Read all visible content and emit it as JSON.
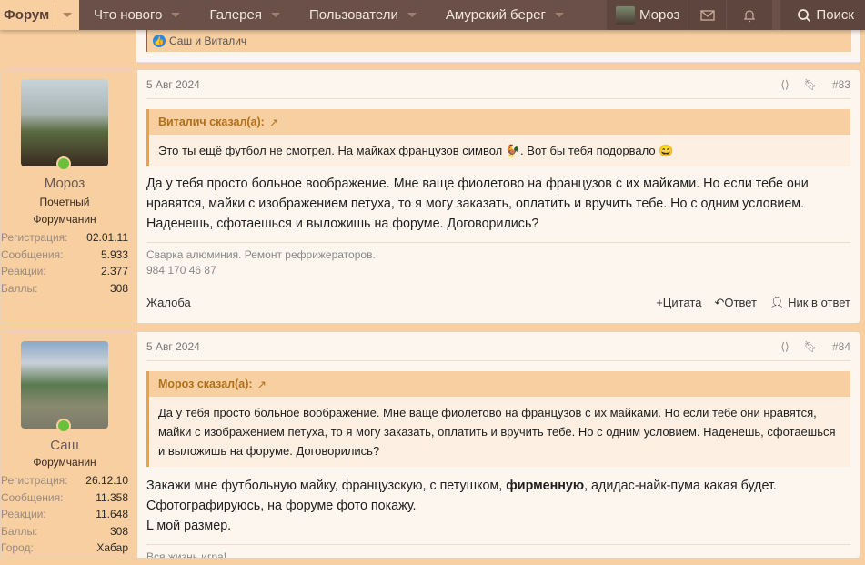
{
  "nav": {
    "forum": "Форум",
    "items": [
      "Что нового",
      "Галерея",
      "Пользователи",
      "Амурский берег"
    ],
    "user": "Мороз",
    "search": "Поиск"
  },
  "prev": {
    "reactions": "Саш и Виталич"
  },
  "posts": [
    {
      "author": "Мороз",
      "title_lines": [
        "Почетный",
        "Форумчанин"
      ],
      "stats": [
        [
          "Регистрация:",
          "02.01.11"
        ],
        [
          "Сообщения:",
          "5.933"
        ],
        [
          "Реакции:",
          "2.377"
        ],
        [
          "Баллы:",
          "308"
        ]
      ],
      "date": "5 Авг 2024",
      "number": "#83",
      "quote_author": "Виталич сказал(а):",
      "quote_text": "Это ты ещё футбол не смотрел. На майках французов символ 🐓. Вот бы тебя подорвало 😄",
      "message": "Да у тебя просто больное воображение. Мне ваще фиолетово на французов с их майками. Но если тебе они нравятся, майки с изображением петуха, то я могу заказать, оплатить и вручить тебе. Но с одним условием. Наденешь, сфотаешься и выложишь на форуме. Договорились?",
      "signature": [
        "Сварка алюминия. Ремонт рефрижераторов.",
        "984 170 46 87"
      ],
      "report": "Жалоба",
      "quote_btn": "Цитата",
      "reply_btn": "Ответ",
      "nick_btn": "Ник в ответ"
    },
    {
      "author": "Саш",
      "title_lines": [
        "Форумчанин"
      ],
      "stats": [
        [
          "Регистрация:",
          "26.12.10"
        ],
        [
          "Сообщения:",
          "11.358"
        ],
        [
          "Реакции:",
          "11.648"
        ],
        [
          "Баллы:",
          "308"
        ],
        [
          "Город:",
          "Хабар"
        ]
      ],
      "date": "5 Авг 2024",
      "number": "#84",
      "quote_author": "Мороз сказал(а):",
      "quote_text": "Да у тебя просто больное воображение. Мне ваще фиолетово на французов с их майками. Но если тебе они нравятся, майки с изображением петуха, то я могу заказать, оплатить и вручить тебе. Но с одним условием. Наденешь, сфотаешься и выложишь на форуме. Договорились?",
      "message_pre": "Закажи мне футбольную майку, французскую, с петушком, ",
      "message_bold": "фирменную",
      "message_post": ", адидас-найк-пума какая будет.",
      "message_line2": "Сфотографируюсь, на форуме фото покажу.",
      "message_line3": "L мой размер.",
      "signature": [
        "Вся жизнь игра!"
      ]
    }
  ]
}
